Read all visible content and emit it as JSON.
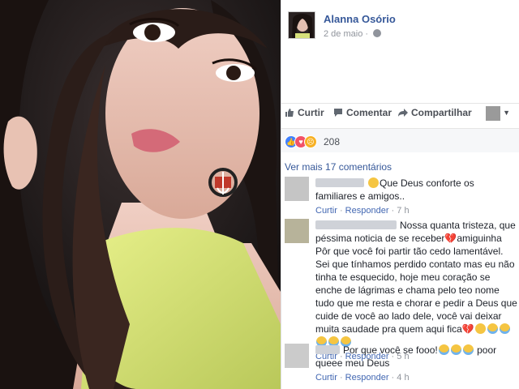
{
  "post": {
    "author": "Alanna Osório",
    "date": "2 de maio",
    "privacy_icon": "globe-icon"
  },
  "actions": {
    "like": "Curtir",
    "comment": "Comentar",
    "share": "Compartilhar"
  },
  "reactions": {
    "count": "208",
    "icons": [
      "like-icon",
      "love-icon",
      "sad-icon"
    ]
  },
  "more_comments": "Ver mais 17 comentários",
  "comments": [
    {
      "text": "Que Deus conforte os familiares e amigos..",
      "like": "Curtir",
      "reply": "Responder",
      "time": "7 h"
    },
    {
      "text_1": "Nossa quanta tristeza, que péssima noticia de se receber",
      "text_2": "amiguinha Pôr que você foi partir tão cedo lamentável. Sei que tínhamos perdido contato mas eu não tinha te esquecido, hoje meu coração se enche de lágrimas e chama pelo teo nome tudo que me resta e chorar e pedir a Deus que cuide de você ao lado dele, você vai deixar muita saudade pra quem aqui fica",
      "like": "Curtir",
      "reply": "Responder",
      "time": "5 h"
    },
    {
      "text_1": "Por que você se fooo!",
      "text_2": "poor queee meu Deus",
      "like": "Curtir",
      "reply": "Responder",
      "time": "4 h"
    }
  ],
  "colors": {
    "link": "#365899",
    "accent": "#4267b2",
    "meta": "#90949c",
    "like": "#4080ff",
    "love": "#f25268",
    "sad": "#f7b125"
  }
}
